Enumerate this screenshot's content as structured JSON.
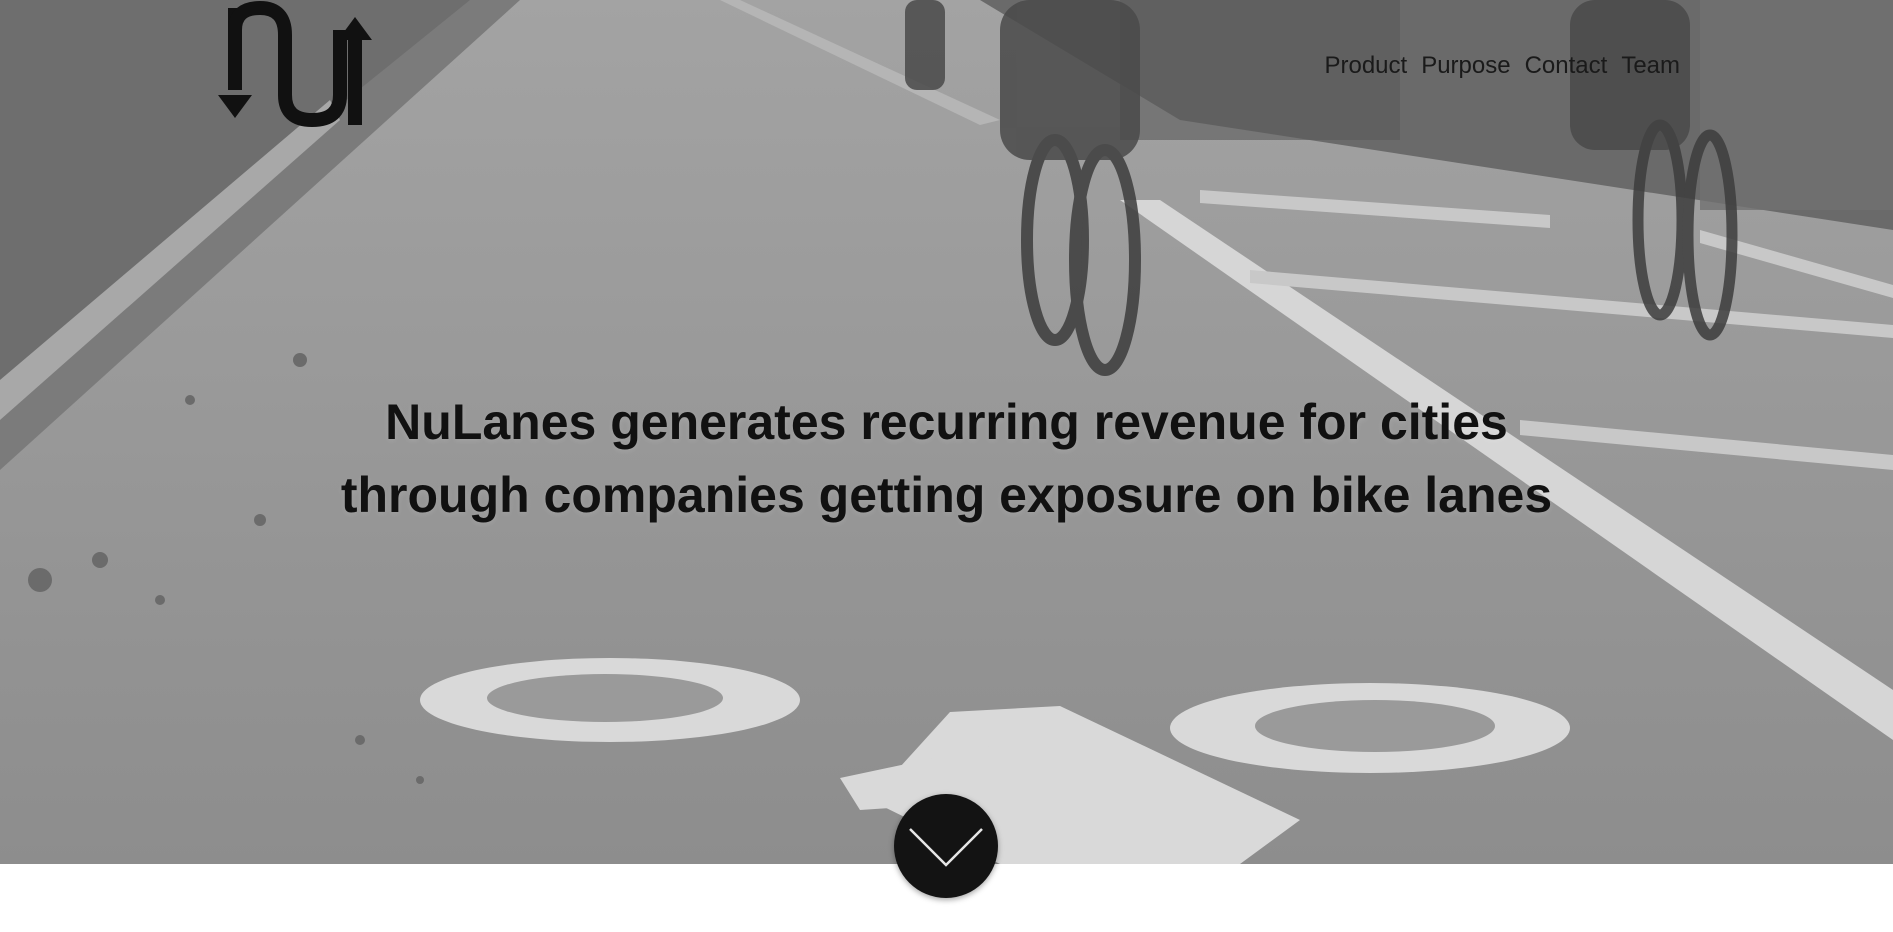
{
  "brand": {
    "logo_icon": "nu-arrows-logo-icon"
  },
  "nav": {
    "items": [
      {
        "label": "Product"
      },
      {
        "label": "Purpose"
      },
      {
        "label": "Contact"
      },
      {
        "label": "Team"
      }
    ]
  },
  "hero": {
    "headline_line1": "NuLanes generates recurring revenue for cities",
    "headline_line2": "through companies getting exposure on bike lanes",
    "scroll_icon": "chevron-down-icon"
  },
  "colors": {
    "hero_tint": "#8f8f8f",
    "text": "#111111",
    "button": "#131313",
    "lane_marking": "#d9d9d9"
  }
}
